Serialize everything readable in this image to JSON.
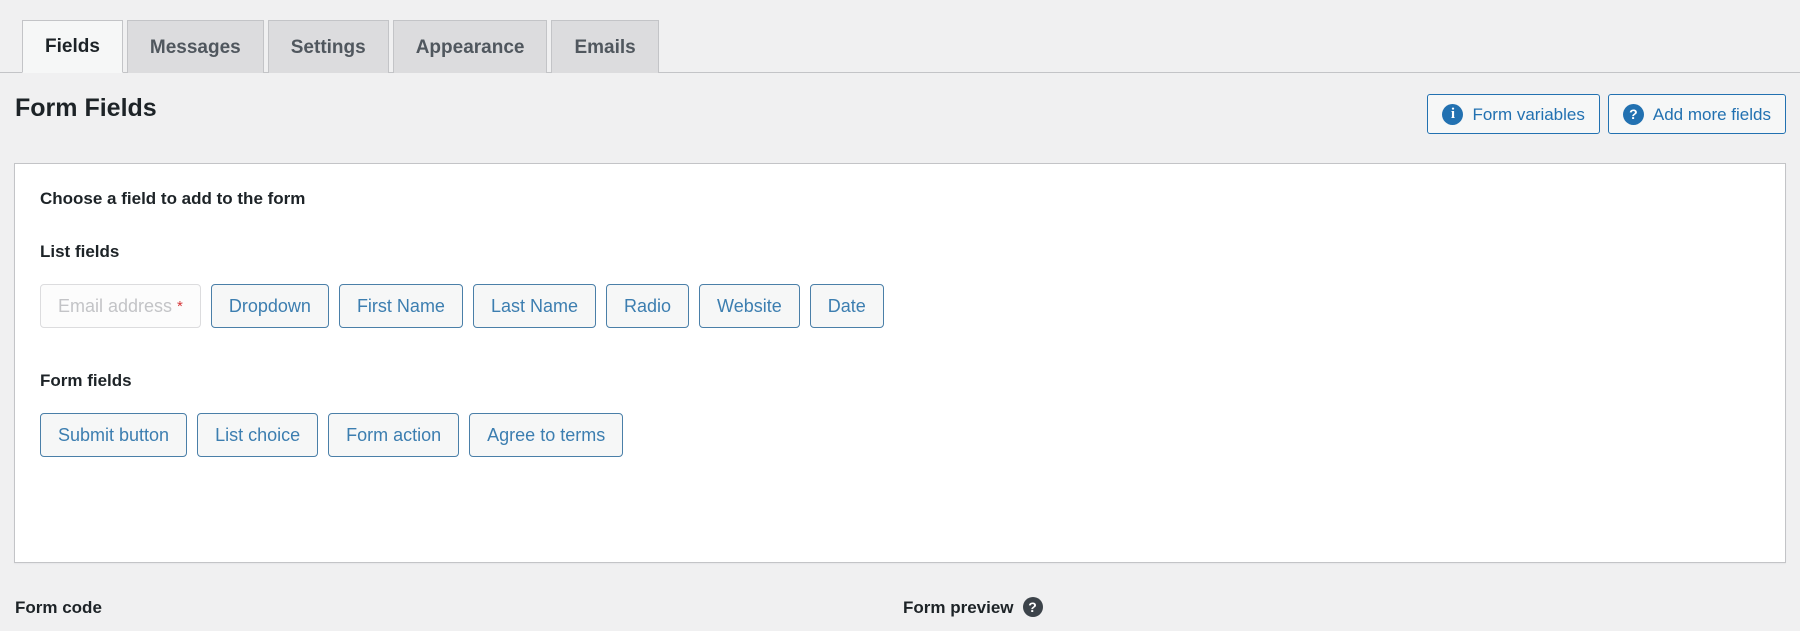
{
  "tabs": [
    {
      "label": "Fields",
      "active": true
    },
    {
      "label": "Messages",
      "active": false
    },
    {
      "label": "Settings",
      "active": false
    },
    {
      "label": "Appearance",
      "active": false
    },
    {
      "label": "Emails",
      "active": false
    }
  ],
  "header": {
    "title": "Form Fields",
    "actions": [
      {
        "label": "Form variables",
        "icon": "info-icon",
        "glyph": "i"
      },
      {
        "label": "Add more fields",
        "icon": "question-icon",
        "glyph": "?"
      }
    ]
  },
  "card": {
    "lead_label": "Choose a field to add to the form",
    "groups": [
      {
        "label": "List fields",
        "chips": [
          {
            "label": "Email address",
            "required": true,
            "disabled": true,
            "required_mark": "*"
          },
          {
            "label": "Dropdown",
            "required": false,
            "disabled": false
          },
          {
            "label": "First Name",
            "required": false,
            "disabled": false
          },
          {
            "label": "Last Name",
            "required": false,
            "disabled": false
          },
          {
            "label": "Radio",
            "required": false,
            "disabled": false
          },
          {
            "label": "Website",
            "required": false,
            "disabled": false
          },
          {
            "label": "Date",
            "required": false,
            "disabled": false
          }
        ]
      },
      {
        "label": "Form fields",
        "chips": [
          {
            "label": "Submit button",
            "required": false,
            "disabled": false
          },
          {
            "label": "List choice",
            "required": false,
            "disabled": false
          },
          {
            "label": "Form action",
            "required": false,
            "disabled": false
          },
          {
            "label": "Agree to terms",
            "required": false,
            "disabled": false
          }
        ]
      }
    ]
  },
  "footer": {
    "form_code_label": "Form code",
    "form_preview_label": "Form preview",
    "form_preview_help_glyph": "?"
  },
  "colors": {
    "page_bg": "#f0f0f1",
    "accent_blue": "#2271b1",
    "chip_blue": "#3c7eb0",
    "required_red": "#d63638",
    "text_dark": "#1d2327",
    "border_grey": "#c3c4c7"
  }
}
